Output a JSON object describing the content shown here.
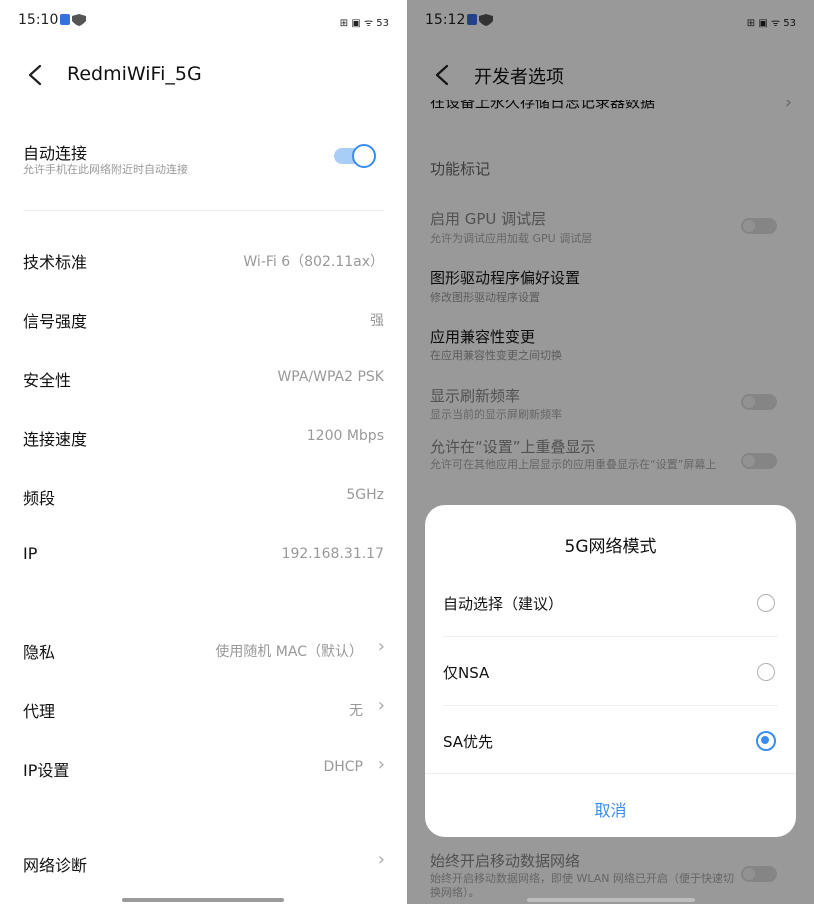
{
  "left": {
    "status": {
      "time": "15:10",
      "right_icons": "⊞ ▣ ᯤ 53"
    },
    "header": {
      "title": "RedmiWiFi_5G"
    },
    "auto_connect": {
      "label": "自动连接",
      "sub": "允许手机在此网络附近时自动连接",
      "enabled": true
    },
    "info_rows": [
      {
        "label": "技术标准",
        "value": "Wi-Fi 6（802.11ax）"
      },
      {
        "label": "信号强度",
        "value": "强"
      },
      {
        "label": "安全性",
        "value": "WPA/WPA2 PSK"
      },
      {
        "label": "连接速度",
        "value": "1200 Mbps"
      },
      {
        "label": "频段",
        "value": "5GHz"
      },
      {
        "label": "IP",
        "value": "192.168.31.17"
      }
    ],
    "setting_rows": [
      {
        "label": "隐私",
        "value": "使用随机 MAC（默认）"
      },
      {
        "label": "代理",
        "value": "无"
      },
      {
        "label": "IP设置",
        "value": "DHCP"
      }
    ],
    "diagnose": {
      "label": "网络诊断"
    }
  },
  "right": {
    "status": {
      "time": "15:12",
      "right_icons": "⊞ ▣ ᯤ 53"
    },
    "header": {
      "title": "开发者选项"
    },
    "items": {
      "persist_log": "在设备上永久存储日志记录器数据",
      "feature_flags": "功能标记",
      "gpu_debug": {
        "title": "启用 GPU 调试层",
        "sub": "允许为调试应用加载 GPU 调试层"
      },
      "gpu_driver": {
        "title": "图形驱动程序偏好设置",
        "sub": "修改图形驱动程序设置"
      },
      "app_compat": {
        "title": "应用兼容性变更",
        "sub": "在应用兼容性变更之间切换"
      },
      "refresh_rate": {
        "title": "显示刷新频率",
        "sub": "显示当前的显示屏刷新频率"
      },
      "overlay": {
        "title": "允许在“设置”上重叠显示",
        "sub": "允许可在其他应用上层显示的应用重叠显示在“设置”屏幕上"
      },
      "mobile_data": {
        "title": "始终开启移动数据网络",
        "sub": "始终开启移动数据网络，即使 WLAN 网络已开启（便于快速切换网络）。"
      }
    },
    "dialog": {
      "title": "5G网络模式",
      "options": [
        {
          "label": "自动选择（建议）",
          "selected": false
        },
        {
          "label": "仅NSA",
          "selected": false
        },
        {
          "label": "SA优先",
          "selected": true
        }
      ],
      "cancel": "取消"
    }
  },
  "colors": {
    "accent": "#3a8df0",
    "dim_overlay": "#000000"
  }
}
